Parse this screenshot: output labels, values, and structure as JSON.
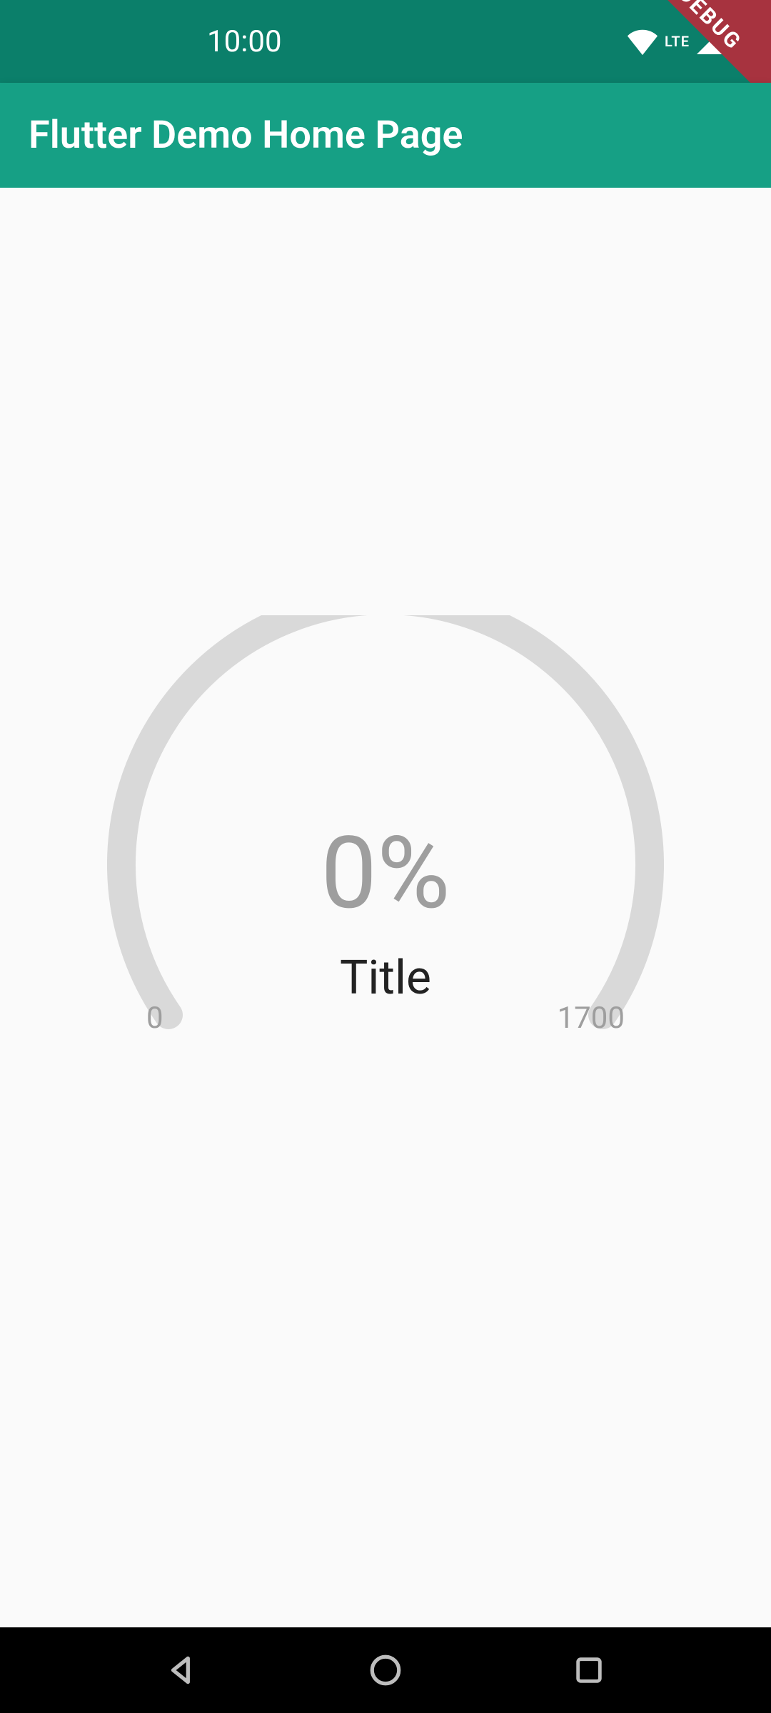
{
  "statusbar": {
    "time": "10:00",
    "lte_label": "LTE"
  },
  "debug_banner": "DEBUG",
  "appbar": {
    "title": "Flutter Demo Home Page"
  },
  "gauge": {
    "percent_text": "0%",
    "title": "Title",
    "min_label": "0",
    "max_label": "1700"
  },
  "colors": {
    "statusbar_bg": "#0b7f6a",
    "appbar_bg": "#16a085",
    "debug_banner_bg": "#a7333f",
    "gauge_track": "#d9d9d9",
    "muted_text": "#9e9e9e"
  },
  "chart_data": {
    "type": "gauge",
    "value": 0,
    "min": 0,
    "max": 1700,
    "percent": 0,
    "title": "Title"
  }
}
